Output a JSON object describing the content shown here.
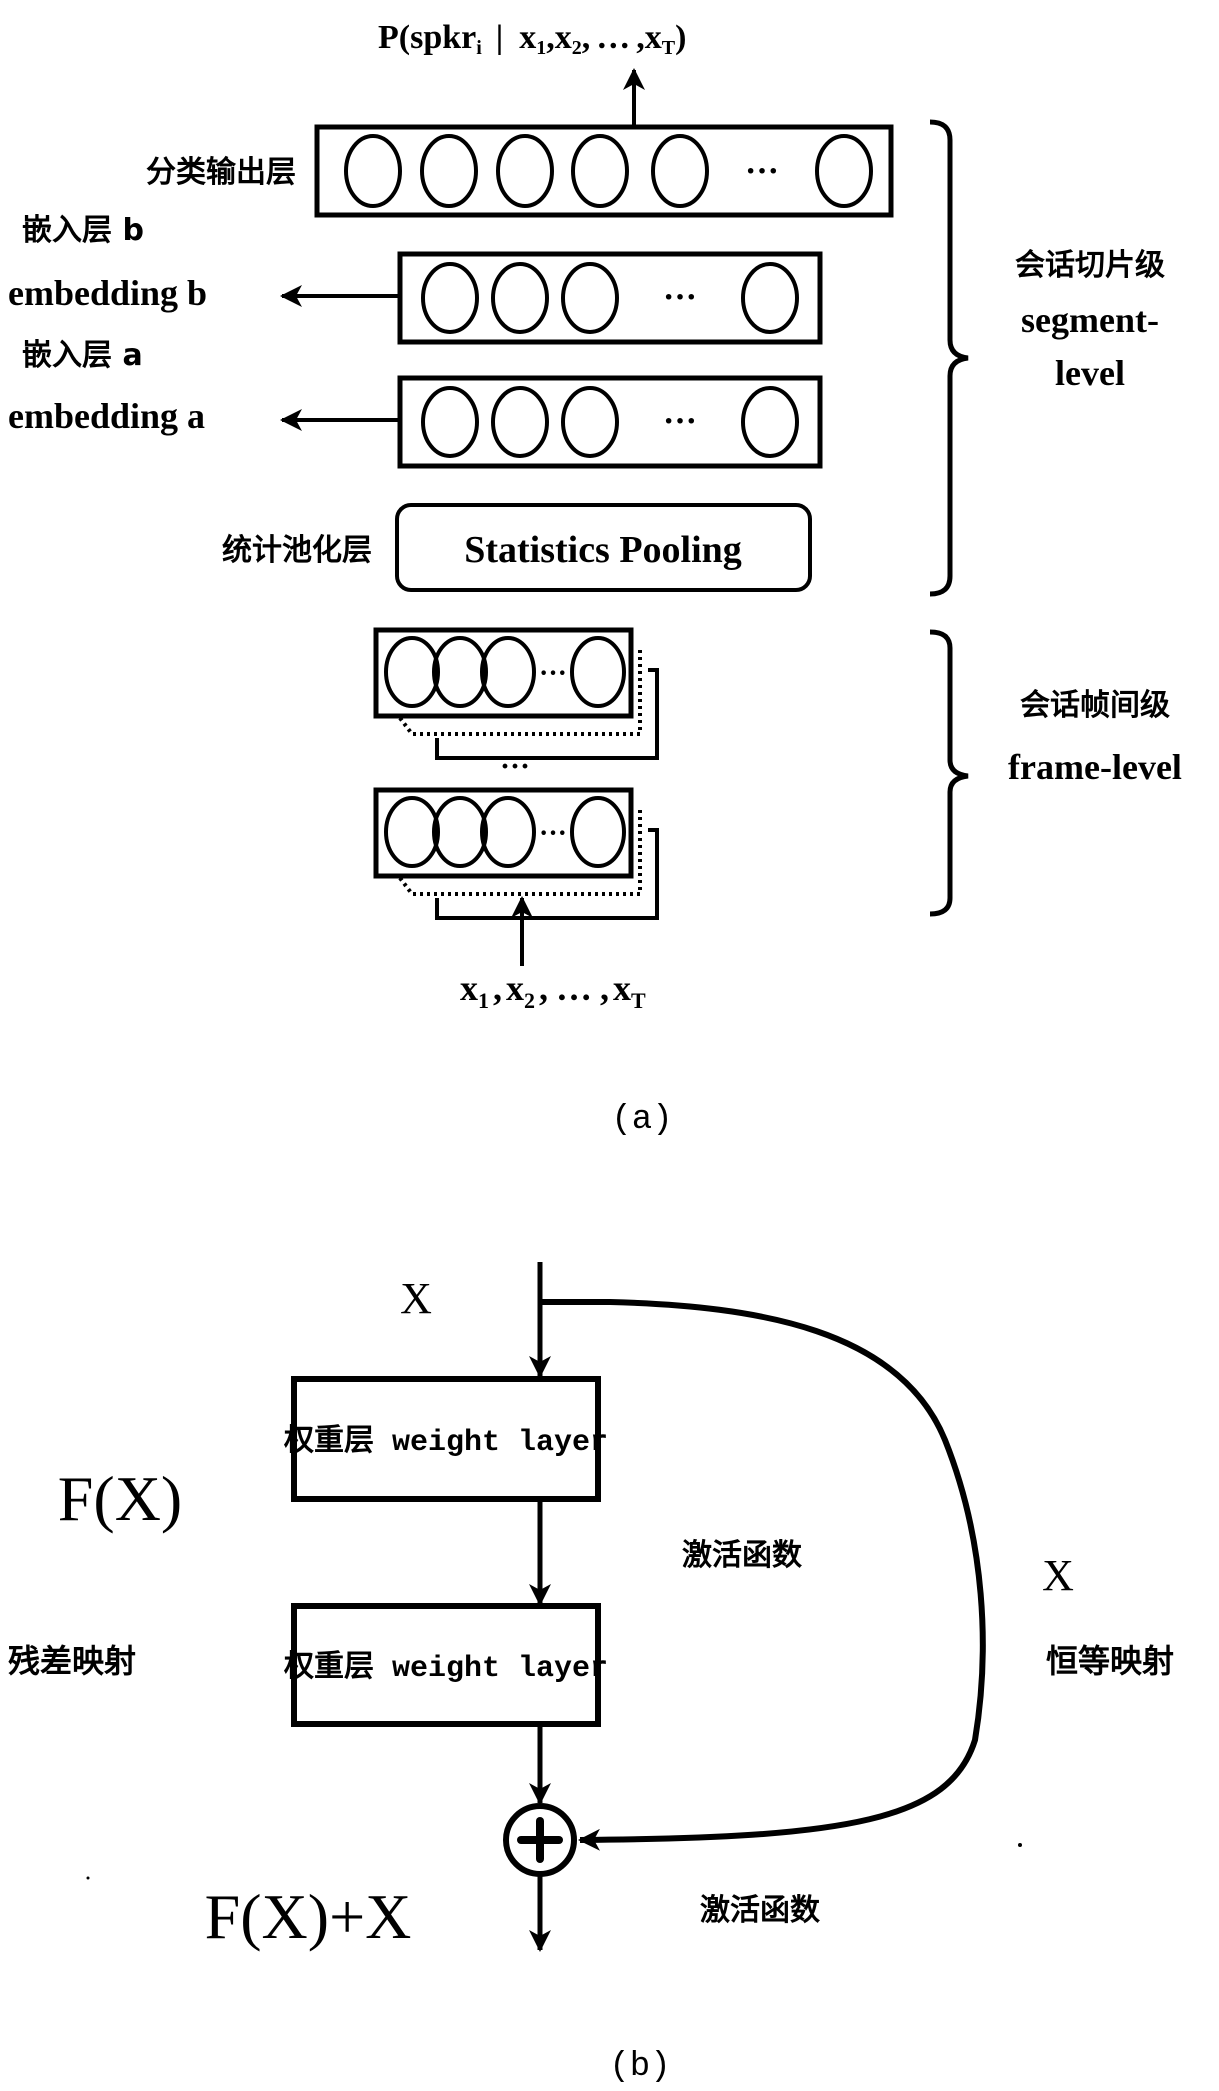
{
  "figure_a": {
    "output_label": "P(spkr",
    "output_label_sub": "i",
    "output_label_bar": "|",
    "output_label_x1": "x",
    "output_label_x1_sub": "1",
    "output_label_x2": "x",
    "output_label_x2_sub": "2",
    "output_label_dots": "…",
    "output_label_xT": "x",
    "output_label_xT_sub": "T",
    "output_label_close": ")",
    "layers": {
      "classification_output": {
        "label_zh": "分类输出层",
        "node_count_visible": 6,
        "ellipsis": "···"
      },
      "embedding_b": {
        "label_zh": "嵌入层 b",
        "label_en": "embedding b",
        "node_count_visible": 4,
        "ellipsis": "···"
      },
      "embedding_a": {
        "label_zh": "嵌入层 a",
        "label_en": "embedding a",
        "node_count_visible": 4,
        "ellipsis": "···"
      },
      "statistics_pooling": {
        "label_zh": "统计池化层",
        "label_en": "Statistics Pooling"
      },
      "frame_layers": {
        "node_count_visible": 4,
        "ellipsis": "···",
        "between_ellipsis": "···"
      }
    },
    "brackets": {
      "segment_level": {
        "zh": "会话切片级",
        "en_line1": "segment-",
        "en_line2": "level"
      },
      "frame_level": {
        "zh": "会话帧间级",
        "en": "frame-level"
      }
    },
    "input_label": {
      "x1": "x",
      "x1_sub": "1",
      "x2": "x",
      "x2_sub": "2",
      "dots": "…",
      "xT": "x",
      "xT_sub": "T",
      "comma": ","
    },
    "caption": "(a)"
  },
  "figure_b": {
    "input_label": "X",
    "weight_layer_1": "权重层 weight layer",
    "weight_layer_2": "权重层 weight layer",
    "activation_1": "激活函数",
    "activation_2": "激活函数",
    "residual_function": "F(X)",
    "residual_mapping": "残差映射",
    "identity_label": "X",
    "identity_mapping": "恒等映射",
    "sum_symbol": "+",
    "output_label": "F(X)+X",
    "caption": "(b)"
  }
}
